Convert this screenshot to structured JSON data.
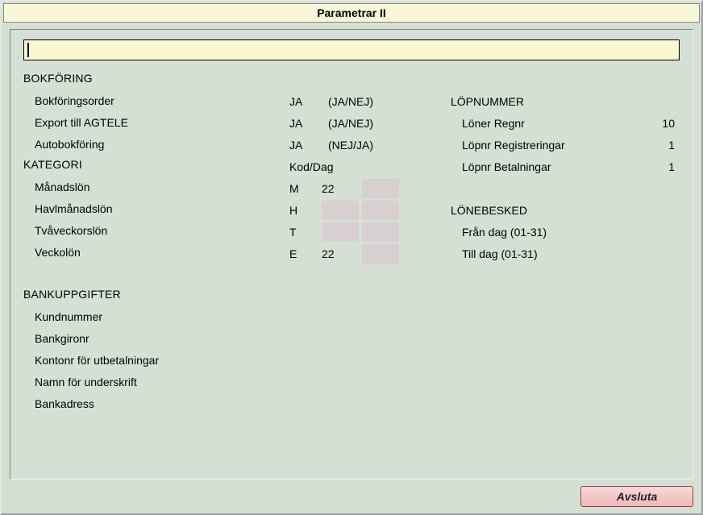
{
  "title": "Parametrar II",
  "bokforing": {
    "header": "BOKFÖRING",
    "rows": [
      {
        "label": "Bokföringsorder",
        "value": "JA",
        "hint": "(JA/NEJ)"
      },
      {
        "label": "Export till AGTELE",
        "value": "JA",
        "hint": "(JA/NEJ)"
      },
      {
        "label": "Autobokföring",
        "value": "JA",
        "hint": "(NEJ/JA)"
      }
    ]
  },
  "kategori": {
    "header": "KATEGORI",
    "mid_header": "Kod/Dag",
    "rows": [
      {
        "label": "Månadslön",
        "kod": "M",
        "dag": "22",
        "grey": false
      },
      {
        "label": "Havlmånadslön",
        "kod": "H",
        "dag": "",
        "grey": true
      },
      {
        "label": "Tvåveckorslön",
        "kod": "T",
        "dag": "",
        "grey": true
      },
      {
        "label": "Veckolön",
        "kod": "E",
        "dag": "22",
        "grey": true
      }
    ]
  },
  "bank": {
    "header": "BANKUPPGIFTER",
    "rows": [
      "Kundnummer",
      "Bankgironr",
      "Kontonr för utbetalningar",
      "Namn för underskrift",
      "Bankadress"
    ]
  },
  "lopnummer": {
    "header": "LÖPNUMMER",
    "rows": [
      {
        "label": "Löner Regnr",
        "value": "10"
      },
      {
        "label": "Löpnr Registreringar",
        "value": "1"
      },
      {
        "label": "Löpnr Betalningar",
        "value": "1"
      }
    ]
  },
  "lonebesked": {
    "header": "LÖNEBESKED",
    "rows": [
      "Från dag  (01-31)",
      "Till dag  (01-31)"
    ]
  },
  "footer": {
    "close": "Avsluta"
  }
}
